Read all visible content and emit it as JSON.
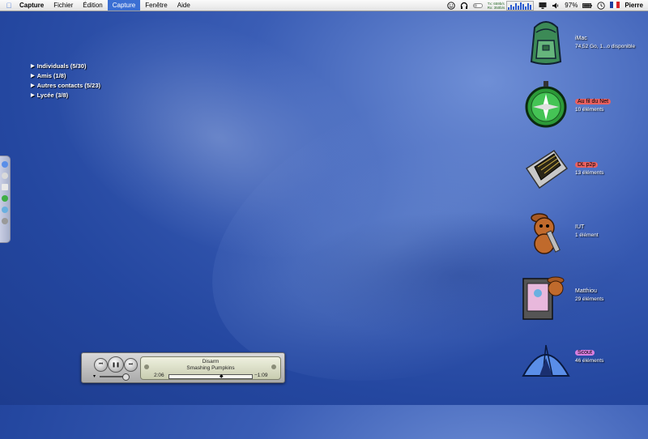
{
  "menubar": {
    "apple_icon": "apple-logo",
    "items": [
      {
        "label": "Capture"
      },
      {
        "label": "Fichier"
      },
      {
        "label": "Édition"
      },
      {
        "label": "Capture"
      },
      {
        "label": "Fenêtre"
      },
      {
        "label": "Aide"
      }
    ],
    "status": {
      "net_tx_label": "Tx",
      "net_rx_label": "Rx",
      "net_tx": "659b/s",
      "net_rx": "350b/s",
      "battery": "97%",
      "flag": "fr",
      "user": "Pierre"
    }
  },
  "groups": [
    {
      "label": "Individuals (5/30)"
    },
    {
      "label": "Amis (1/8)"
    },
    {
      "label": "Autres contacts (5/23)"
    },
    {
      "label": "Lycée (3/8)"
    }
  ],
  "desktop": [
    {
      "name": "iMac",
      "sub": "74,52 Go, 1...o disponible",
      "icon": "backpack-icon",
      "tag": ""
    },
    {
      "name": "Au fil du Net",
      "sub": "10 éléments",
      "icon": "compass-icon",
      "tag": "#e96060"
    },
    {
      "name": "DL p2p",
      "sub": "13 éléments",
      "icon": "chip-icon",
      "tag": "#e96060"
    },
    {
      "name": "IUT",
      "sub": "1 élément",
      "icon": "rabbit-wrench-icon",
      "tag": ""
    },
    {
      "name": "Matthiou",
      "sub": "29 éléments",
      "icon": "rabbit-clipboard-icon",
      "tag": ""
    },
    {
      "name": "Scout",
      "sub": "46 éléments",
      "icon": "tent-icon",
      "tag": "#d97fe0"
    }
  ],
  "player": {
    "song": "Disarm",
    "artist": "Smashing Pumpkins",
    "elapsed": "2:06",
    "remaining": "−1:09"
  },
  "colors": {
    "menu_highlight": "#3b6fd3",
    "desktop": "#2447a0"
  }
}
